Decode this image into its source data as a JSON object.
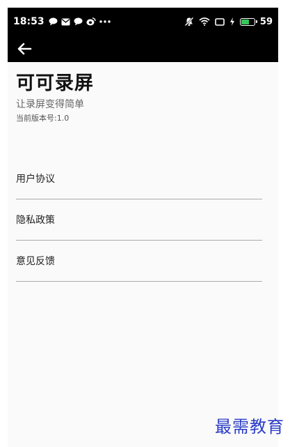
{
  "statusbar": {
    "time": "18:53",
    "left_icons": [
      "chat-bubble-icon",
      "mail-icon",
      "chat-bubble-icon",
      "weibo-icon",
      "more-dots-icon"
    ],
    "right_icons": [
      "mute-bell-icon",
      "wifi-icon",
      "screen-icon",
      "charging-icon",
      "battery-icon"
    ],
    "battery_level": "59",
    "battery_color": "#34c759"
  },
  "toolbar": {
    "back_icon": "arrow-left-icon"
  },
  "app": {
    "title": "可可录屏",
    "subtitle": "让录屏变得简单",
    "version": "当前版本号:1.0"
  },
  "menu": {
    "items": [
      {
        "label": "用户协议"
      },
      {
        "label": "隐私政策"
      },
      {
        "label": "意见反馈"
      }
    ]
  },
  "watermark": {
    "text": "最需教育",
    "color": "#2a3cc8"
  }
}
